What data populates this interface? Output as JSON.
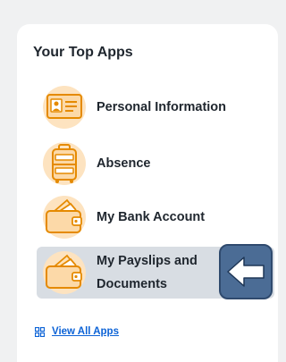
{
  "card": {
    "title": "Your Top Apps"
  },
  "apps": [
    {
      "label": "Personal Information",
      "icon": "id-card-icon"
    },
    {
      "label": "Absence",
      "icon": "suitcase-icon"
    },
    {
      "label": "My Bank Account",
      "icon": "wallet-icon"
    },
    {
      "label": "My Payslips and Documents",
      "line1": "My Payslips and",
      "line2": "Documents",
      "icon": "wallet-icon",
      "highlighted": true
    }
  ],
  "view_all": {
    "label": "View All Apps",
    "icon": "grid-icon"
  },
  "back_arrow": {
    "icon": "left-arrow-icon"
  },
  "colors": {
    "icon_orange": "#f5a623",
    "icon_circle": "#fde3c0",
    "link_blue": "#0b62d6",
    "highlight_bg": "#d8dde3",
    "arrow_button_bg": "#4b6c95"
  }
}
